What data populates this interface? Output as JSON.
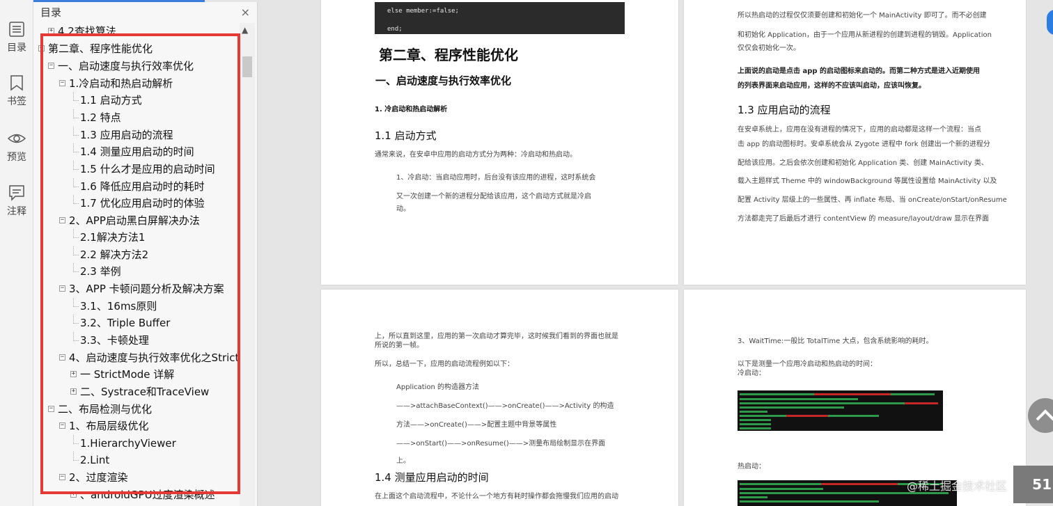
{
  "rail": {
    "toc_label": "目录",
    "bookmark_label": "书签",
    "preview_label": "预览",
    "notes_label": "注释"
  },
  "toc": {
    "header": "目录",
    "close_glyph": "×",
    "items": [
      {
        "text": "4.2查找算法",
        "expander": "+"
      },
      {
        "text": "第二章、程序性能优化",
        "expander": "−"
      },
      {
        "text": "一、启动速度与执行效率优化",
        "expander": "−"
      },
      {
        "text": "1.冷启动和热启动解析",
        "expander": "−"
      },
      {
        "text": "1.1 启动方式",
        "expander": ""
      },
      {
        "text": "1.2 特点",
        "expander": ""
      },
      {
        "text": "1.3 应用启动的流程",
        "expander": ""
      },
      {
        "text": "1.4 测量应用启动的时间",
        "expander": ""
      },
      {
        "text": "1.5 什么才是应用的启动时间",
        "expander": ""
      },
      {
        "text": "1.6 降低应用启动时的耗时",
        "expander": ""
      },
      {
        "text": "1.7 优化应用启动时的体验",
        "expander": ""
      },
      {
        "text": "2、APP启动黑白屏解决办法",
        "expander": "−"
      },
      {
        "text": "2.1解决方法1",
        "expander": ""
      },
      {
        "text": "2.2 解决方法2",
        "expander": ""
      },
      {
        "text": "2.3 举例",
        "expander": ""
      },
      {
        "text": "3、APP 卡顿问题分析及解决方案",
        "expander": "−"
      },
      {
        "text": "3.1、16ms原则",
        "expander": ""
      },
      {
        "text": "3.2、Triple Buffer",
        "expander": ""
      },
      {
        "text": "3.3、卡顿处理",
        "expander": ""
      },
      {
        "text": "4、启动速度与执行效率优化之StrictMode",
        "expander": "−"
      },
      {
        "text": "一 StrictMode 详解",
        "expander": "+"
      },
      {
        "text": "二、Systrace和TraceView",
        "expander": "+"
      },
      {
        "text": "二、布局检测与优化",
        "expander": "−"
      },
      {
        "text": "1、布局层级优化",
        "expander": "−"
      },
      {
        "text": "1.HierarchyViewer",
        "expander": ""
      },
      {
        "text": "2.Lint",
        "expander": ""
      },
      {
        "text": "2、过度渲染",
        "expander": "−"
      },
      {
        "text": "、androidGPU过度渲染概述",
        "expander": "+"
      }
    ]
  },
  "page1": {
    "code_lines": [
      "else member:=false;",
      "end;"
    ],
    "chapter_title": "第二章、程序性能优化",
    "section_title": "一、启动速度与执行效率优化",
    "sub_title": "1. 冷启动和热启动解析",
    "h_1_1": "1.1  启动方式",
    "para1": "通常来说，在安卓中应用的启动方式分为两种：冷启动和热启动。",
    "para2_lines": [
      "1、冷启动：当启动应用时，后台没有该应用的进程，这时系统会",
      "又一次创建一个新的进程分配给该应用，这个启动方式就是冷启",
      "动。"
    ]
  },
  "page2": {
    "lines_top": [
      "所以热启动的过程仅仅须要创建和初始化一个 MainActivity 即可了。而不必创建",
      "和初始化 Application，由于一个应用从新进程的创建到进程的销毁。Application",
      "仅仅会初始化一次。"
    ],
    "bold_lines": [
      "上面说的启动是点击 app 的启动图标来启动的。而第二种方式是进入近期使用",
      "的列表界面来启动应用，这样的不应该叫启动，应该叫恢复。"
    ],
    "h_1_3": "1.3  应用启动的流程",
    "lines_bottom": [
      "在安卓系统上，应用在没有进程的情况下，应用的启动都是这样一个流程：当点",
      "击 app 的启动图标时。安卓系统会从 Zygote 进程中 fork 创建出一个新的进程分",
      "配给该应用。之后会依次创建和初始化 Application 类、创建 MainActivity 类、",
      "载入主题样式 Theme 中的 windowBackground 等属性设置给 MainActivity 以及",
      "配置 Activity 层级上的一些属性、再 inflate 布局、当 onCreate/onStart/onResume",
      "方法都走完了后最后才进行 contentView 的 measure/layout/draw 显示在界面"
    ]
  },
  "page3": {
    "lines_a": [
      "上，所以直到这里，应用的第一次启动才算完毕，这时候我们看到的界面也就是",
      "所说的第一帧。"
    ],
    "line_b": "所以，总结一下，应用的启动流程例如以下：",
    "flow_lines": [
      "Application 的构造器方法",
      "——>attachBaseContext()——>onCreate()——>Activity 的构造",
      "方法——>onCreate()——>配置主题中背景等属性",
      "——>onStart()——>onResume()——>测量布局绘制显示在界面",
      "上。"
    ],
    "h_1_4": "1.4  测量应用启动的时间",
    "bottom_line": "在上面这个启动流程中，不论什么一个地方有耗时操作都会拖慢我们应用的启动"
  },
  "page4": {
    "line1": "3、WaitTime:一般比 TotalTime 大点，包含系统影响的耗时。",
    "line2": "以下是测量一个应用冷启动和热启动的时间：",
    "line3": "冷启动：",
    "line4": "热启动："
  },
  "floating": {
    "watermark": "@稀土掘金技术社区",
    "page_number": "51",
    "scroll_top_glyph": "⌃"
  },
  "colors": {
    "highlight_frame": "#e53935",
    "accent": "#3b7ddd",
    "code_bg": "#2b2b2b",
    "terminal_bg": "#111111"
  }
}
